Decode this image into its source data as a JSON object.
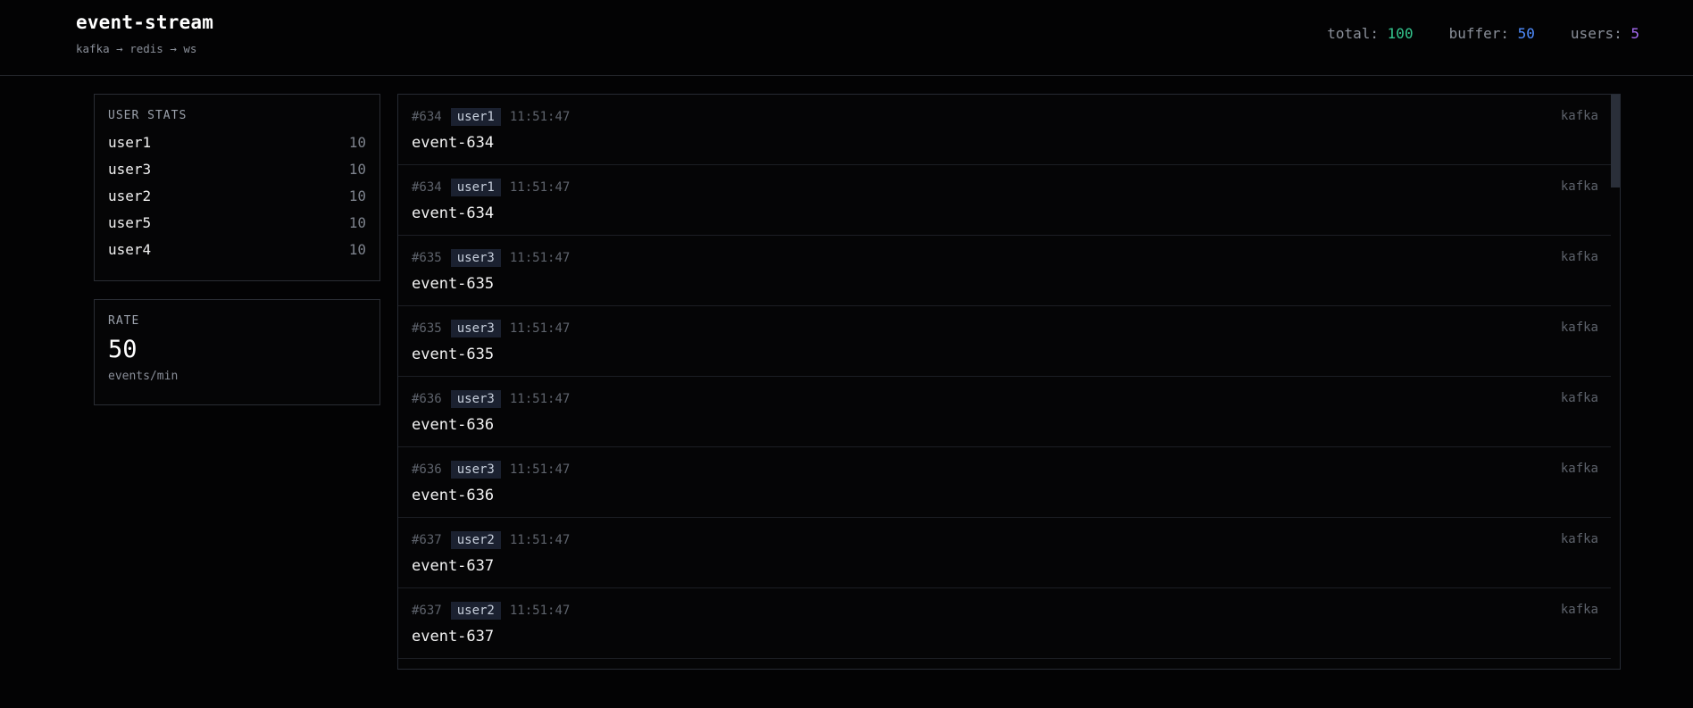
{
  "header": {
    "title": "event-stream",
    "subtitle": "kafka → redis → ws",
    "stats": {
      "total_label": "total:",
      "total_value": "100",
      "buffer_label": "buffer:",
      "buffer_value": "50",
      "users_label": "users:",
      "users_value": "5"
    }
  },
  "user_stats": {
    "title": "USER STATS",
    "users": [
      {
        "name": "user1",
        "count": "10"
      },
      {
        "name": "user3",
        "count": "10"
      },
      {
        "name": "user2",
        "count": "10"
      },
      {
        "name": "user5",
        "count": "10"
      },
      {
        "name": "user4",
        "count": "10"
      }
    ]
  },
  "rate": {
    "title": "RATE",
    "value": "50",
    "unit": "events/min"
  },
  "feed": {
    "events": [
      {
        "id": "#634",
        "user": "user1",
        "time": "11:51:47",
        "name": "event-634",
        "source": "kafka"
      },
      {
        "id": "#634",
        "user": "user1",
        "time": "11:51:47",
        "name": "event-634",
        "source": "kafka"
      },
      {
        "id": "#635",
        "user": "user3",
        "time": "11:51:47",
        "name": "event-635",
        "source": "kafka"
      },
      {
        "id": "#635",
        "user": "user3",
        "time": "11:51:47",
        "name": "event-635",
        "source": "kafka"
      },
      {
        "id": "#636",
        "user": "user3",
        "time": "11:51:47",
        "name": "event-636",
        "source": "kafka"
      },
      {
        "id": "#636",
        "user": "user3",
        "time": "11:51:47",
        "name": "event-636",
        "source": "kafka"
      },
      {
        "id": "#637",
        "user": "user2",
        "time": "11:51:47",
        "name": "event-637",
        "source": "kafka"
      },
      {
        "id": "#637",
        "user": "user2",
        "time": "11:51:47",
        "name": "event-637",
        "source": "kafka"
      }
    ]
  },
  "colors": {
    "total": "#34c58e",
    "buffer": "#4f8dff",
    "users": "#a66bf2"
  }
}
